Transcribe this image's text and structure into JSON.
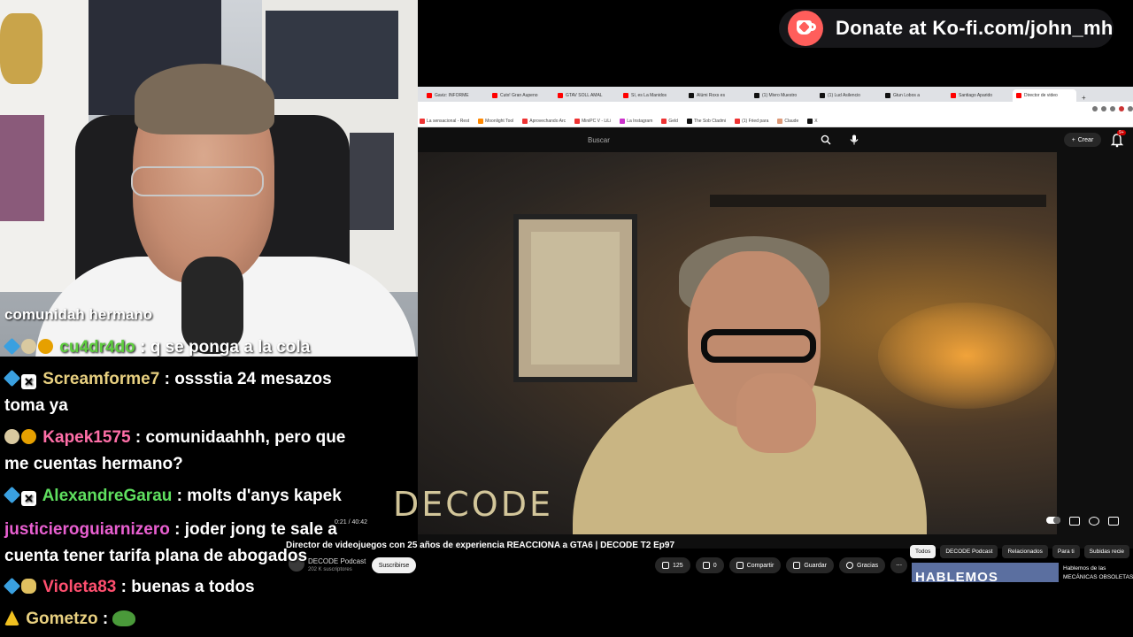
{
  "donate": {
    "text": "Donate at Ko-fi.com/john_mh"
  },
  "browser": {
    "tabs": [
      "Gaviz: INFORME",
      "Cutx! Gran Aupeno",
      "GTAV SOLL AMAL",
      "Sí, es La Manidos",
      "Alúmi Roxs es",
      "(1) Mivro Muestro",
      "(1) Lud Asilencio",
      "Gtun Lobos a",
      "Santiago Aparido",
      "Director de video"
    ],
    "bookmarks": [
      "La sensacional - Rest",
      "Moonlight Tool",
      "Aprovechando Arc",
      "MiniPC V - LiLi",
      "La Instagram",
      "Geld",
      "The Sob Ctadmi",
      "(1) Fried para",
      "Claude",
      "X"
    ],
    "search_placeholder": "Buscar",
    "create_label": "Crear",
    "notif_count": "9+"
  },
  "video": {
    "watermark": "DECODE",
    "time": "0:21 / 40:42",
    "title": "Director de videojuegos con 25 años de experiencia REACCIONA a GTA6 | DECODE T2 Ep97",
    "channel": "DECODE Podcast",
    "subscribers": "202 K suscriptores",
    "subscribe_label": "Suscribirse",
    "likes": "125",
    "dislikes": "0",
    "share_label": "Compartir",
    "save_label": "Guardar",
    "thanks_label": "Gracias"
  },
  "chips": [
    "Todos",
    "DECODE Podcast",
    "Relacionados",
    "Para ti",
    "Subidas recie"
  ],
  "recommendation": {
    "thumb_text": "HABLEMOS",
    "title": "Hablemos de las MECÁNICAS OBSOLETAS"
  },
  "chat": [
    {
      "user": "",
      "user_color": "#ffffff",
      "message": "comunidah hermano",
      "badges": []
    },
    {
      "user": "cu4dr4do",
      "user_color": "#5fcf3f",
      "message": ": q se ponga a la cola",
      "badges": [
        "prime",
        "skull",
        "coin"
      ]
    },
    {
      "user": "Screamforme7",
      "user_color": "#e8d080",
      "message": ": ossstia 24 mesazos",
      "badges": [
        "prime",
        "x"
      ]
    },
    {
      "user": "",
      "user_color": "#ffffff",
      "message": "toma ya",
      "badges": []
    },
    {
      "user": "Kapek1575",
      "user_color": "#ff6fa8",
      "message": ": comunidaahhh, pero que",
      "badges": [
        "skull",
        "coin"
      ]
    },
    {
      "user": "",
      "user_color": "#ffffff",
      "message": "me cuentas hermano?",
      "badges": []
    },
    {
      "user": "AlexandreGarau",
      "user_color": "#5fdf5f",
      "message": ": molts d'anys kapek",
      "badges": [
        "prime",
        "x"
      ]
    },
    {
      "user": "justicieroguiarnizero",
      "user_color": "#e85fd0",
      "message": ": joder jong te sale a",
      "badges": []
    },
    {
      "user": "",
      "user_color": "#ffffff",
      "message": "cuenta tener tarifa plana de abogados",
      "badges": []
    },
    {
      "user": "Violeta83",
      "user_color": "#ff4f6f",
      "message": ": buenas a todos",
      "badges": [
        "prime",
        "bear"
      ]
    },
    {
      "user": "Gometzo",
      "user_color": "#e8d080",
      "message": ":",
      "badges": [
        "warn"
      ]
    }
  ],
  "colors": {
    "kofi": "#ff5e5b",
    "yt_bg": "#0f0f0f",
    "yt_red": "#cc0000"
  }
}
